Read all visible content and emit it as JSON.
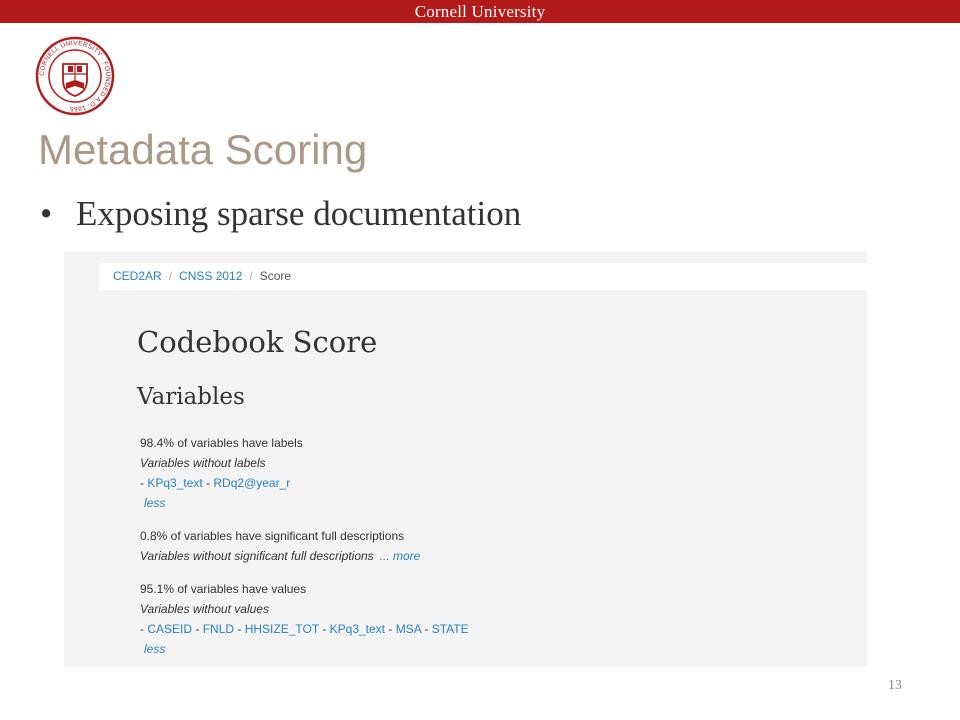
{
  "header": {
    "institution": "Cornell University"
  },
  "seal": {
    "text": "CORNELL UNIVERSITY · FOUNDED A.D. 1865",
    "color": "#b31b1b"
  },
  "slide": {
    "title": "Metadata Scoring",
    "bullet": "Exposing sparse documentation",
    "page_number": "13"
  },
  "screenshot": {
    "breadcrumb": {
      "items": [
        "CED2AR",
        "CNSS 2012"
      ],
      "current": "Score"
    },
    "heading": "Codebook Score",
    "subheading": "Variables",
    "sections": [
      {
        "stat": "98.4% of variables have labels",
        "missing_heading": "Variables without labels",
        "variables": [
          "KPq3_text",
          "RDq2@year_r"
        ],
        "toggle": "less"
      },
      {
        "stat": "0.8% of variables have significant full descriptions",
        "missing_heading": "Variables without significant full descriptions",
        "more": "... more"
      },
      {
        "stat": "95.1% of variables have values",
        "missing_heading": "Variables without values",
        "variables": [
          "CASEID",
          "FNLD",
          "HHSIZE_TOT",
          "KPq3_text",
          "MSA",
          "STATE"
        ],
        "toggle": "less"
      }
    ]
  },
  "colors": {
    "brand_red": "#b31b1b",
    "title_taupe": "#a89a86",
    "link_blue": "#2a7fc0"
  }
}
